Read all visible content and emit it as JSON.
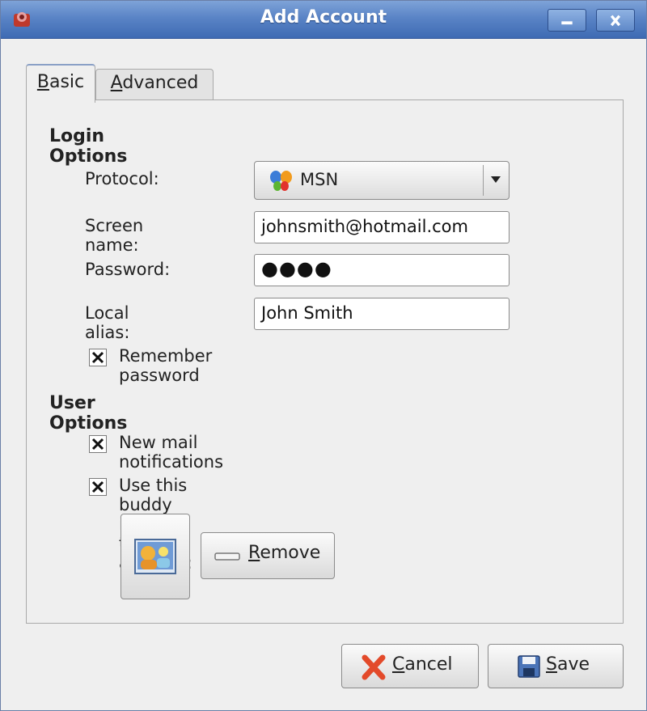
{
  "window": {
    "title": "Add Account"
  },
  "tabs": [
    {
      "key": "B",
      "rest": "asic",
      "active": true
    },
    {
      "key": "A",
      "rest": "dvanced",
      "active": false
    }
  ],
  "login_options": {
    "heading": "Login Options",
    "protocol_label": "Protocol:",
    "protocol_value": "MSN",
    "screen_name_label": "Screen name:",
    "screen_name_value": "johnsmith@hotmail.com",
    "password_label": "Password:",
    "password_value": "●●●●",
    "local_alias_label": "Local alias:",
    "local_alias_value": "John Smith",
    "remember_password": {
      "label": "Remember password",
      "checked": true
    }
  },
  "user_options": {
    "heading": "User Options",
    "new_mail": {
      "label": "New mail notifications",
      "checked": true
    },
    "buddy_icon": {
      "label": "Use this buddy icon for this account:",
      "checked": true
    },
    "remove_button": {
      "key": "R",
      "rest": "emove"
    }
  },
  "buttons": {
    "cancel": {
      "key": "C",
      "rest": "ancel"
    },
    "save": {
      "key": "S",
      "rest": "ave"
    }
  },
  "colors": {
    "titlebar": "#5a84c6",
    "window_bg": "#efefef",
    "cancel_icon": "#e34a2a",
    "save_icon": "#4a74b8"
  }
}
